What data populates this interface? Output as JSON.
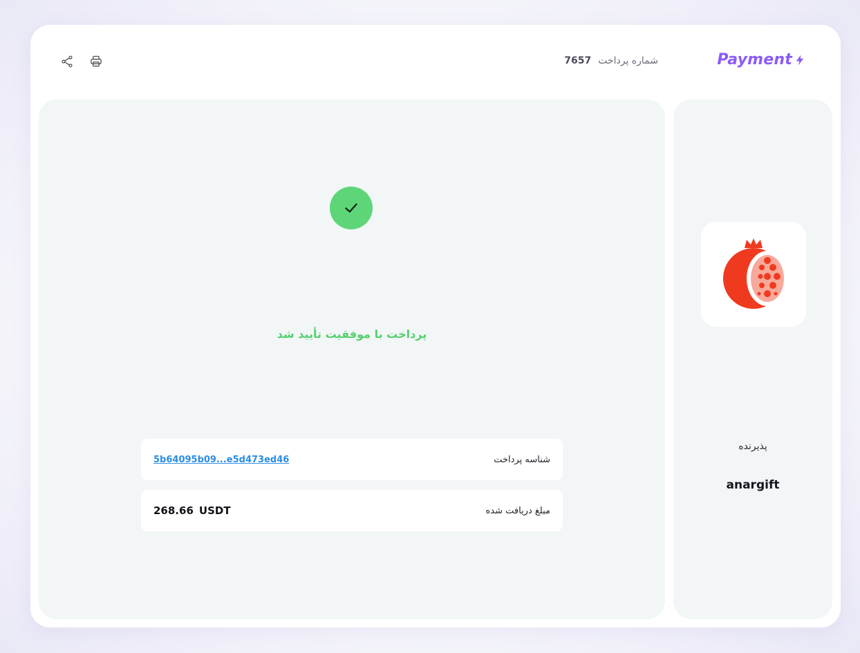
{
  "header": {
    "brand": "Payment",
    "payment_number_label": "شماره پرداخت",
    "payment_number": "7657",
    "share_icon": "share-icon",
    "print_icon": "print-icon"
  },
  "main": {
    "status_icon": "check-icon",
    "status_text": "پرداخت با موفقیت تأیید شد",
    "rows": [
      {
        "label": "شناسه پرداخت",
        "value": "5b64095b09...e5d473ed46"
      },
      {
        "label": "مبلغ دریافت شده",
        "amount": "268.66",
        "currency": "USDT"
      }
    ]
  },
  "side": {
    "logo_icon": "pomegranate-logo",
    "receiver_label": "پذیرنده",
    "receiver_name": "anargift"
  },
  "colors": {
    "brand": "#8b5cf6",
    "success": "#5ed678",
    "link": "#2b8de6",
    "logo_red": "#f03a1f"
  }
}
